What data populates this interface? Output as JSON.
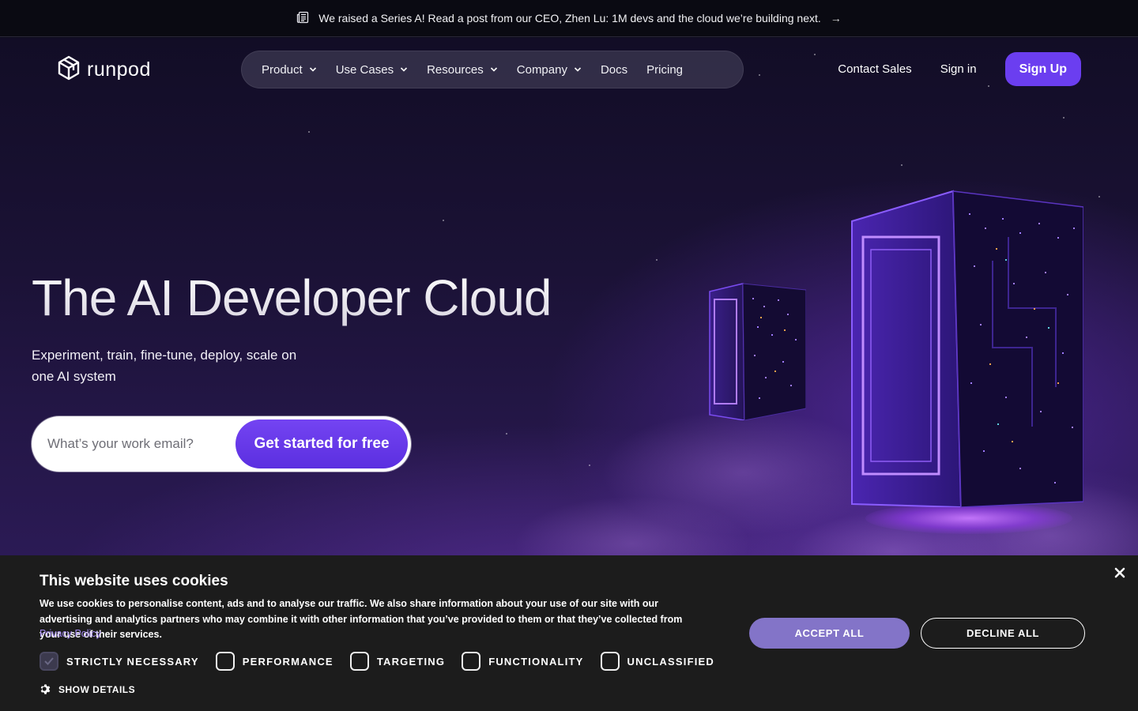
{
  "announcement": {
    "icon": "newspaper-icon",
    "text": "We raised a Series A! Read a post from our CEO, Zhen Lu: 1M devs and the cloud we’re building next.",
    "arrow": "→"
  },
  "brand": {
    "name": "runpod",
    "accent": "#6b3ef0"
  },
  "nav": {
    "items": [
      {
        "label": "Product",
        "dropdown": true
      },
      {
        "label": "Use Cases",
        "dropdown": true
      },
      {
        "label": "Resources",
        "dropdown": true
      },
      {
        "label": "Company",
        "dropdown": true
      },
      {
        "label": "Docs",
        "dropdown": false
      },
      {
        "label": "Pricing",
        "dropdown": false
      }
    ],
    "contact_sales": "Contact Sales",
    "sign_in": "Sign in",
    "sign_up": "Sign Up"
  },
  "hero": {
    "title": "The AI Developer Cloud",
    "subtitle": "Experiment, train, fine-tune, deploy, scale on one AI system",
    "email_placeholder": "What’s your work email?",
    "cta": "Get started for free"
  },
  "cookie_banner": {
    "title": "This website uses cookies",
    "body": "We use cookies to personalise content, ads and to analyse our traffic. We also share information about your use of our site with our advertising and analytics partners who may combine it with other information that you’ve provided to them or that they’ve collected from your use of their services.",
    "privacy_link": "Privacy Policy",
    "categories": [
      {
        "label": "STRICTLY NECESSARY",
        "checked": true
      },
      {
        "label": "PERFORMANCE",
        "checked": false
      },
      {
        "label": "TARGETING",
        "checked": false
      },
      {
        "label": "FUNCTIONALITY",
        "checked": false
      },
      {
        "label": "UNCLASSIFIED",
        "checked": false
      }
    ],
    "show_details": "SHOW DETAILS",
    "accept_all": "ACCEPT ALL",
    "decline_all": "DECLINE ALL",
    "accept_color": "#8374c8"
  }
}
